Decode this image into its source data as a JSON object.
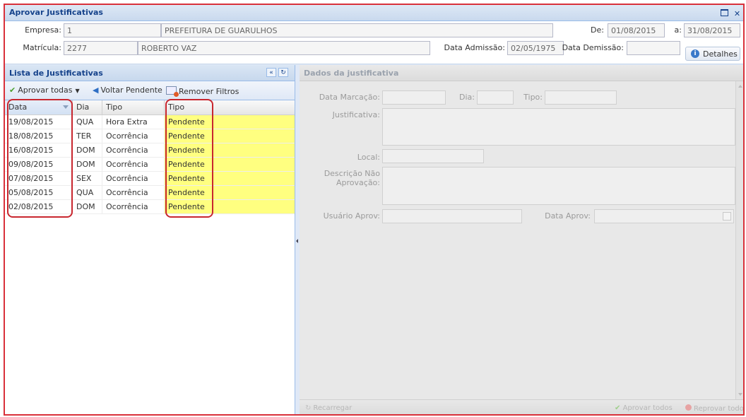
{
  "window": {
    "title": "Aprovar Justificativas"
  },
  "header": {
    "empresa_label": "Empresa:",
    "empresa_code": "1",
    "empresa_name": "PREFEITURA DE GUARULHOS",
    "de_label": "De:",
    "de_value": "01/08/2015",
    "a_label": "a:",
    "a_value": "31/08/2015",
    "matricula_label": "Matrícula:",
    "matricula_value": "2277",
    "employee_name": "ROBERTO VAZ",
    "admissao_label": "Data Admissão:",
    "admissao_value": "02/05/1975",
    "demissao_label": "Data Demissão:",
    "demissao_value": "",
    "details_button": "Detalhes"
  },
  "list_panel": {
    "title": "Lista de Justificativas",
    "toolbar": {
      "approve_all": "Aprovar todas",
      "back_pending": "Voltar Pendente",
      "remove_filters": "Remover Filtros"
    },
    "columns": [
      "Data",
      "Dia",
      "Tipo",
      "Tipo"
    ],
    "rows": [
      {
        "data": "19/08/2015",
        "dia": "QUA",
        "tipo": "Hora Extra",
        "status": "Pendente"
      },
      {
        "data": "18/08/2015",
        "dia": "TER",
        "tipo": "Ocorrência",
        "status": "Pendente"
      },
      {
        "data": "16/08/2015",
        "dia": "DOM",
        "tipo": "Ocorrência",
        "status": "Pendente"
      },
      {
        "data": "09/08/2015",
        "dia": "DOM",
        "tipo": "Ocorrência",
        "status": "Pendente"
      },
      {
        "data": "07/08/2015",
        "dia": "SEX",
        "tipo": "Ocorrência",
        "status": "Pendente"
      },
      {
        "data": "05/08/2015",
        "dia": "QUA",
        "tipo": "Ocorrência",
        "status": "Pendente"
      },
      {
        "data": "02/08/2015",
        "dia": "DOM",
        "tipo": "Ocorrência",
        "status": "Pendente"
      }
    ]
  },
  "detail_panel": {
    "title": "Dados da justificativa",
    "data_marcacao_label": "Data Marcação:",
    "dia_label": "Dia:",
    "tipo_label": "Tipo:",
    "justificativa_label": "Justificativa:",
    "local_label": "Local:",
    "descricao_label_1": "Descrição Não",
    "descricao_label_2": "Aprovação:",
    "usuario_aprov_label": "Usuário Aprov:",
    "data_aprov_label": "Data Aprov:",
    "reload_button": "Recarregar",
    "approve_all_button": "Aprovar todos",
    "reject_all_button": "Reprovar todos"
  },
  "colors": {
    "highlight": "#ffff80",
    "annotation": "#c8262e",
    "accent": "#15428b"
  }
}
